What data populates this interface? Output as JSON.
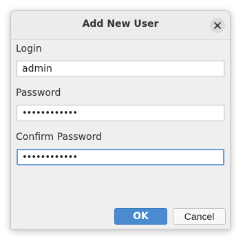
{
  "dialog": {
    "title": "Add New User",
    "close_icon": "close-icon"
  },
  "form": {
    "login_label": "Login",
    "login_value": "admin",
    "password_label": "Password",
    "password_value": "••••••••••••",
    "confirm_label": "Confirm Password",
    "confirm_value": "••••••••••••"
  },
  "buttons": {
    "ok_label": "OK",
    "cancel_label": "Cancel"
  },
  "colors": {
    "accent": "#4a8bd0",
    "focus": "#6a9bd8"
  }
}
